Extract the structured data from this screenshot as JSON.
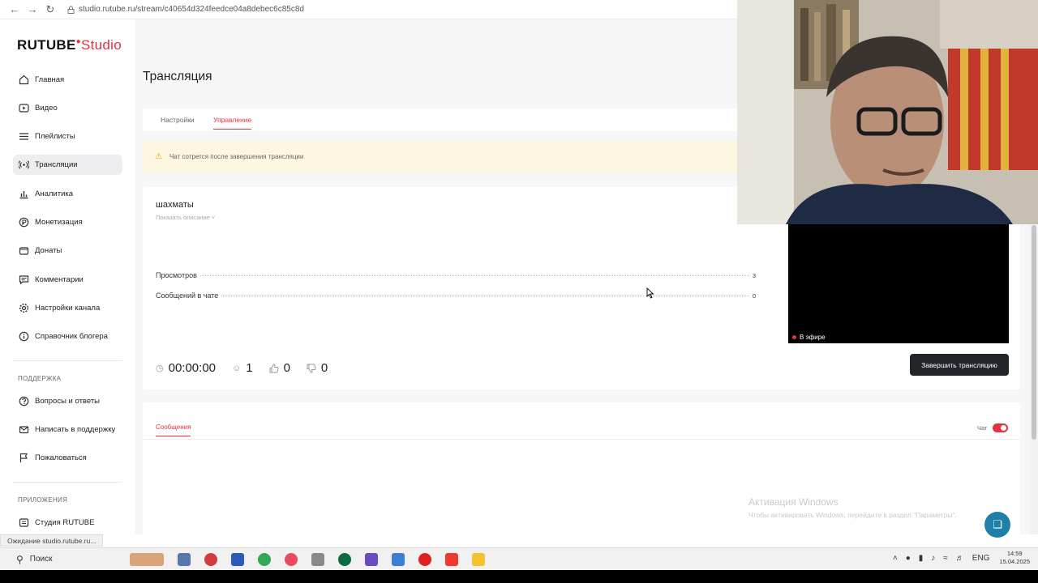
{
  "browser": {
    "url": "studio.rutube.ru/stream/c40654d324feedce04a8debec6c85c8d",
    "status_text": "Ожидание studio.rutube.ru..."
  },
  "logo": {
    "brand": "RUTUBE",
    "product": "Studio"
  },
  "sidebar": {
    "items": [
      {
        "label": "Главная",
        "icon": "home-icon"
      },
      {
        "label": "Видео",
        "icon": "video-icon"
      },
      {
        "label": "Плейлисты",
        "icon": "playlist-icon"
      },
      {
        "label": "Трансляции",
        "icon": "broadcast-icon",
        "active": true
      },
      {
        "label": "Аналитика",
        "icon": "chart-icon"
      },
      {
        "label": "Монетизация",
        "icon": "coin-icon"
      },
      {
        "label": "Донаты",
        "icon": "wallet-icon"
      },
      {
        "label": "Комментарии",
        "icon": "comment-icon"
      },
      {
        "label": "Настройки канала",
        "icon": "gear-icon"
      },
      {
        "label": "Справочник блогера",
        "icon": "info-icon"
      }
    ],
    "support_heading": "ПОДДЕРЖКА",
    "support_items": [
      {
        "label": "Вопросы и ответы",
        "icon": "question-icon"
      },
      {
        "label": "Написать в поддержку",
        "icon": "mail-icon"
      },
      {
        "label": "Пожаловаться",
        "icon": "flag-icon"
      }
    ],
    "apps_heading": "ПРИЛОЖЕНИЯ",
    "apps_items": [
      {
        "label": "Студия RUTUBE",
        "icon": "app-icon"
      }
    ]
  },
  "main": {
    "title": "Трансляция",
    "tabs": [
      "Настройки",
      "Управление"
    ],
    "active_tab": "Управление",
    "alert": "Чат сотрется после завершения трансляции",
    "stream": {
      "name": "шахматы",
      "show_description": "Показать описание",
      "stats": [
        {
          "label": "Просмотров",
          "value": "3"
        },
        {
          "label": "Сообщений в чате",
          "value": "0"
        }
      ],
      "live_badge": "В эфире",
      "timer": "00:00:00",
      "viewers": "1",
      "likes": "0",
      "dislikes": "0",
      "end_button": "Завершить трансляцию"
    },
    "chat": {
      "tab": "Сообщения",
      "toggle_label": "Чат",
      "toggle_on": true
    }
  },
  "watermark": {
    "line1": "Активация Windows",
    "line2": "Чтобы активировать Windows, перейдите в раздел \"Параметры\"."
  },
  "taskbar": {
    "search": "Поиск",
    "lang": "ENG",
    "time": "14:59",
    "date": "15.04.2025"
  },
  "colors": {
    "accent": "#e5323f",
    "alert_bg": "#fdf6e1",
    "button_dark": "#22262b",
    "fab": "#1e7fa8"
  }
}
